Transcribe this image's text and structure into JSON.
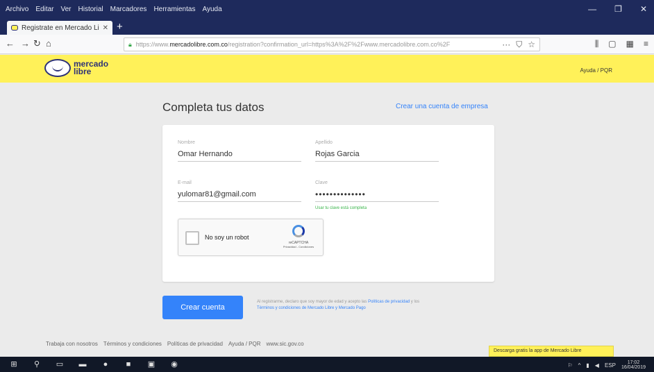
{
  "browser": {
    "menu": [
      "Archivo",
      "Editar",
      "Ver",
      "Historial",
      "Marcadores",
      "Herramientas",
      "Ayuda"
    ],
    "window_controls": [
      "—",
      "❐",
      "✕"
    ],
    "tab_title": "Registrate en Mercado Libre",
    "tab_close": "✕",
    "new_tab": "+",
    "nav": {
      "back": "←",
      "forward": "→",
      "reload": "↻",
      "home": "⌂"
    },
    "url_prefix": "https://www.",
    "url_host": "mercadolibre.com.co",
    "url_rest": "/registration?confirmation_url=https%3A%2F%2Fwww.mercadolibre.com.co%2F",
    "url_actions": [
      "···",
      "⛉",
      "☆"
    ],
    "right_tools": [
      "⫼",
      "▢",
      "▦",
      "≡"
    ]
  },
  "header": {
    "logo_line1": "mercado",
    "logo_line2": "libre",
    "help": "Ayuda / PQR"
  },
  "main": {
    "title": "Completa tus datos",
    "business_link": "Crear una cuenta de empresa"
  },
  "form": {
    "nombre": {
      "label": "Nombre",
      "value": "Omar Hernando"
    },
    "apellido": {
      "label": "Apellido",
      "value": "Rojas Garcia"
    },
    "email": {
      "label": "E-mail",
      "value": "yulomar81@gmail.com"
    },
    "clave": {
      "label": "Clave",
      "value": "••••••••••••••"
    },
    "strength": "Usar tu clave está completa",
    "captcha_label": "No soy un robot",
    "captcha_brand": "reCAPTCHA",
    "captcha_terms": "Privacidad - Condiciones",
    "submit": "Crear cuenta",
    "terms_text": "Al registrarme, declaro que soy mayor de edad y acepto las ",
    "terms_link1": "Políticas de privacidad",
    "terms_mid": " y los ",
    "terms_link2": "Términos y condiciones de Mercado Libre y Mercado Pago"
  },
  "footer": {
    "links": [
      "Trabaja con nosotros",
      "Términos y condiciones",
      "Políticas de privacidad",
      "Ayuda / PQR",
      "www.sic.gov.co"
    ],
    "app_banner": "Descarga gratis la app de Mercado Libre"
  },
  "taskbar": {
    "icons": [
      "⊞",
      "⚲",
      "▭",
      "▬",
      "●",
      "■",
      "▣",
      "◉"
    ],
    "tray": [
      "⚐",
      "^",
      "▮",
      "◀",
      "ESP"
    ],
    "time": "17:02",
    "date": "16/04/2019"
  }
}
